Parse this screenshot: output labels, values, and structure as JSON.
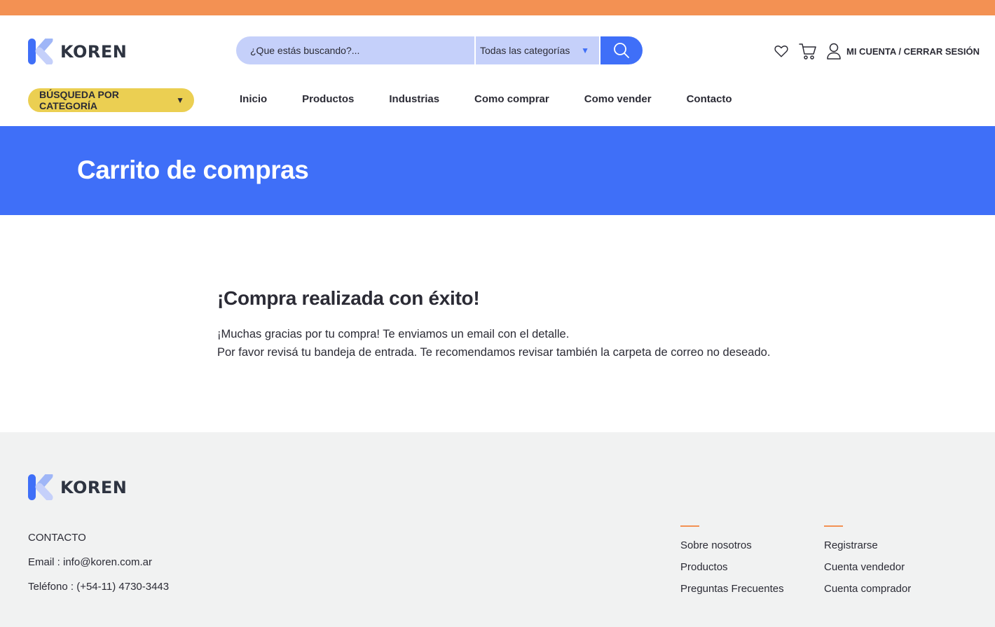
{
  "brand": {
    "name": "KOREN"
  },
  "search": {
    "placeholder": "¿Que estás buscando?...",
    "category_selected": "Todas las categorías"
  },
  "account": {
    "label": "MI CUENTA / CERRAR SESIÓN"
  },
  "category_button": {
    "label": "BÚSQUEDA POR CATEGORÍA"
  },
  "nav": {
    "items": [
      {
        "label": "Inicio"
      },
      {
        "label": "Productos"
      },
      {
        "label": "Industrias"
      },
      {
        "label": "Como comprar"
      },
      {
        "label": "Como vender"
      },
      {
        "label": "Contacto"
      }
    ]
  },
  "banner": {
    "title": "Carrito de compras"
  },
  "main": {
    "heading": "¡Compra realizada con éxito!",
    "line1": "¡Muchas gracias por tu compra! Te enviamos un email con el detalle.",
    "line2": "Por favor revisá tu bandeja de entrada. Te recomendamos revisar también la carpeta de correo no deseado."
  },
  "footer": {
    "contact_title": "CONTACTO",
    "email": "Email : info@koren.com.ar",
    "phone": "Teléfono : (+54-11) 4730-3443",
    "col1": [
      "Sobre nosotros",
      "Productos",
      "Preguntas Frecuentes"
    ],
    "col2": [
      "Registrarse",
      "Cuenta vendedor",
      "Cuenta comprador"
    ]
  },
  "colors": {
    "top_bar": "#f39153",
    "primary_blue": "#3f6ff8",
    "search_bg": "#c5d0fa",
    "category_yellow": "#ebcf52",
    "footer_bg": "#f1f2f2",
    "accent_orange": "#f39153"
  },
  "icons": [
    "heart-icon",
    "cart-icon",
    "user-icon",
    "search-icon",
    "chevron-down-icon"
  ]
}
